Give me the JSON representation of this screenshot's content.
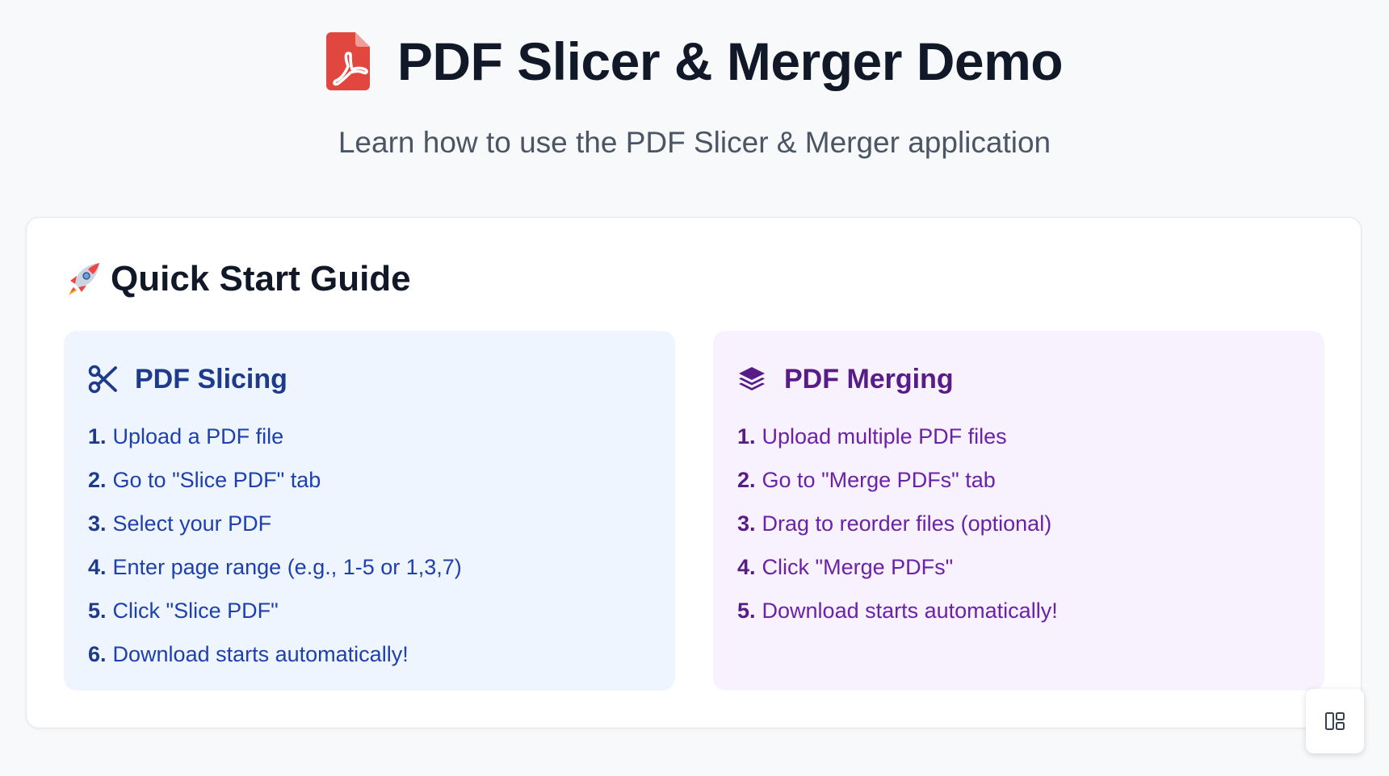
{
  "header": {
    "title": "PDF Slicer & Merger Demo",
    "subtitle": "Learn how to use the PDF Slicer & Merger application",
    "icon": "file-pdf-icon",
    "icon_color": "#e2473f"
  },
  "guide": {
    "title": "Quick Start Guide",
    "icon": "rocket-icon",
    "slicing": {
      "title": "PDF Slicing",
      "icon": "scissors-icon",
      "accent": "#1e3a8a",
      "background": "#eff5fe",
      "steps": [
        {
          "num": "1.",
          "text": "Upload a PDF file"
        },
        {
          "num": "2.",
          "text": "Go to \"Slice PDF\" tab"
        },
        {
          "num": "3.",
          "text": "Select your PDF"
        },
        {
          "num": "4.",
          "text": "Enter page range (e.g., 1-5 or 1,3,7)"
        },
        {
          "num": "5.",
          "text": "Click \"Slice PDF\""
        },
        {
          "num": "6.",
          "text": "Download starts automatically!"
        }
      ]
    },
    "merging": {
      "title": "PDF Merging",
      "icon": "layers-icon",
      "accent": "#581c87",
      "background": "#f7f2fd",
      "steps": [
        {
          "num": "1.",
          "text": "Upload multiple PDF files"
        },
        {
          "num": "2.",
          "text": "Go to \"Merge PDFs\" tab"
        },
        {
          "num": "3.",
          "text": "Drag to reorder files (optional)"
        },
        {
          "num": "4.",
          "text": "Click \"Merge PDFs\""
        },
        {
          "num": "5.",
          "text": "Download starts automatically!"
        }
      ]
    }
  },
  "floating_button": {
    "icon": "layout-icon"
  }
}
